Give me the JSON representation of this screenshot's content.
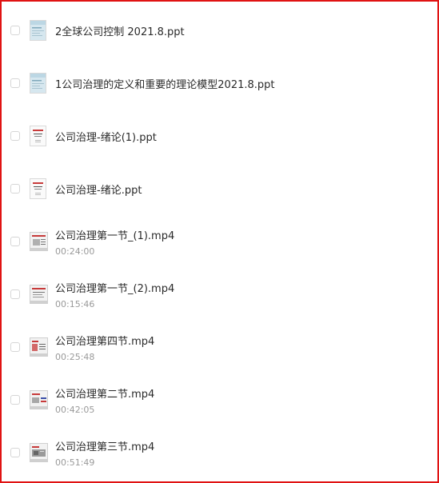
{
  "files": [
    {
      "name": "2全球公司控制 2021.8.ppt",
      "type": "ppt",
      "thumb": "ppt-blue-icon"
    },
    {
      "name": "1公司治理的定义和重要的理论模型2021.8.ppt",
      "type": "ppt",
      "thumb": "ppt-blue-icon"
    },
    {
      "name": "公司治理-绪论(1).ppt",
      "type": "ppt",
      "thumb": "ppt-red-icon"
    },
    {
      "name": "公司治理-绪论.ppt",
      "type": "ppt",
      "thumb": "ppt-red-icon"
    },
    {
      "name": "公司治理第一节_(1).mp4",
      "type": "video",
      "duration": "00:24:00",
      "thumb": "video-icon"
    },
    {
      "name": "公司治理第一节_(2).mp4",
      "type": "video",
      "duration": "00:15:46",
      "thumb": "video-icon"
    },
    {
      "name": "公司治理第四节.mp4",
      "type": "video",
      "duration": "00:25:48",
      "thumb": "video-icon"
    },
    {
      "name": "公司治理第二节.mp4",
      "type": "video",
      "duration": "00:42:05",
      "thumb": "video-icon"
    },
    {
      "name": "公司治理第三节.mp4",
      "type": "video",
      "duration": "00:51:49",
      "thumb": "video-icon"
    }
  ],
  "colors": {
    "frame_border": "#e01313",
    "text": "#2a2a2a",
    "subtext": "#9a9a9a",
    "ppt_blue": "#bcd7e4",
    "ppt_red": "#c93b3b",
    "video_red": "#c73a3a"
  }
}
